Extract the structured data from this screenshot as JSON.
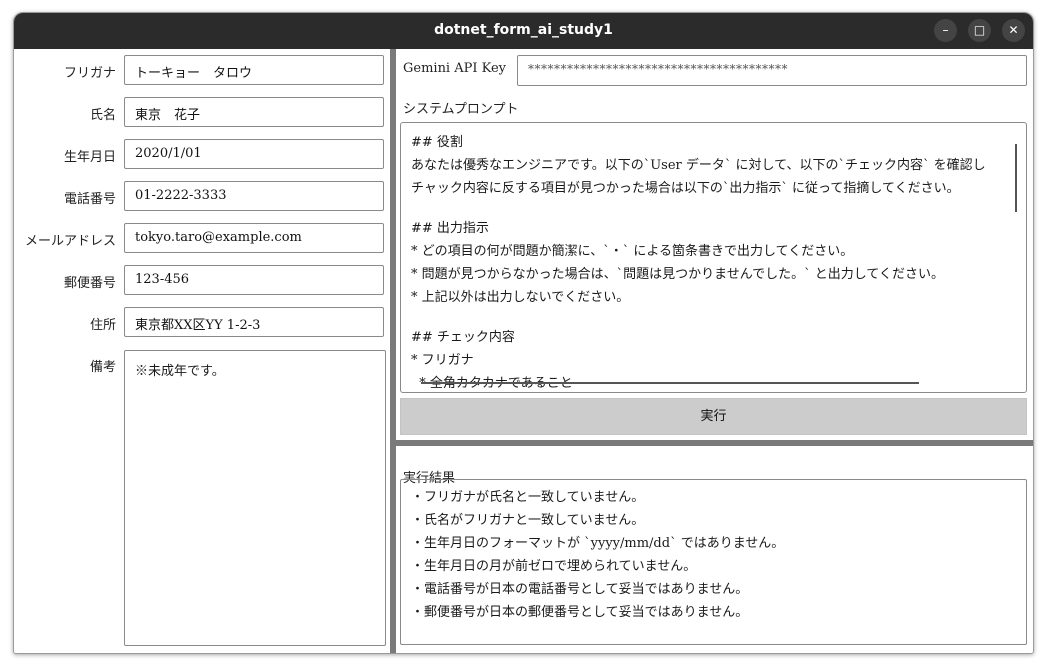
{
  "window": {
    "title": "dotnet_form_ai_study1",
    "minimize_glyph": "–",
    "maximize_glyph": "□",
    "close_glyph": "✕"
  },
  "form": {
    "fields": [
      {
        "label": "フリガナ",
        "value": "トーキョー　タロウ"
      },
      {
        "label": "氏名",
        "value": "東京　花子"
      },
      {
        "label": "生年月日",
        "value": "2020/1/01"
      },
      {
        "label": "電話番号",
        "value": "01-2222-3333"
      },
      {
        "label": "メールアドレス",
        "value": "tokyo.taro@example.com"
      },
      {
        "label": "郵便番号",
        "value": "123-456"
      },
      {
        "label": "住所",
        "value": "東京都XX区YY 1-2-3"
      }
    ],
    "notes_label": "備考",
    "notes_value": "※未成年です。"
  },
  "api": {
    "label": "Gemini API Key",
    "masked_value": "****************************************"
  },
  "prompt": {
    "label": "システムプロンプト",
    "lines": [
      "## 役割",
      "あなたは優秀なエンジニアです。以下の`User データ` に対して、以下の`チェック内容` を確認し",
      "チャック内容に反する項目が見つかった場合は以下の`出力指示` に従って指摘してください。",
      "",
      "## 出力指示",
      "* どの項目の何が問題か簡潔に、`・` による箇条書きで出力してください。",
      "* 問題が見つからなかった場合は、`問題は見つかりませんでした。` と出力してください。",
      "* 上記以外は出力しないでください。",
      "",
      "## チェック内容",
      "* フリガナ",
      "  * 全角カタカナであること"
    ]
  },
  "run_button": {
    "label": "実行"
  },
  "result": {
    "label": "実行結果",
    "lines": [
      "・フリガナが氏名と一致していません。",
      "・氏名がフリガナと一致していません。",
      "・生年月日のフォーマットが `yyyy/mm/dd` ではありません。",
      "・生年月日の月が前ゼロで埋められていません。",
      "・電話番号が日本の電話番号として妥当ではありません。",
      "・郵便番号が日本の郵便番号として妥当ではありません。"
    ]
  }
}
